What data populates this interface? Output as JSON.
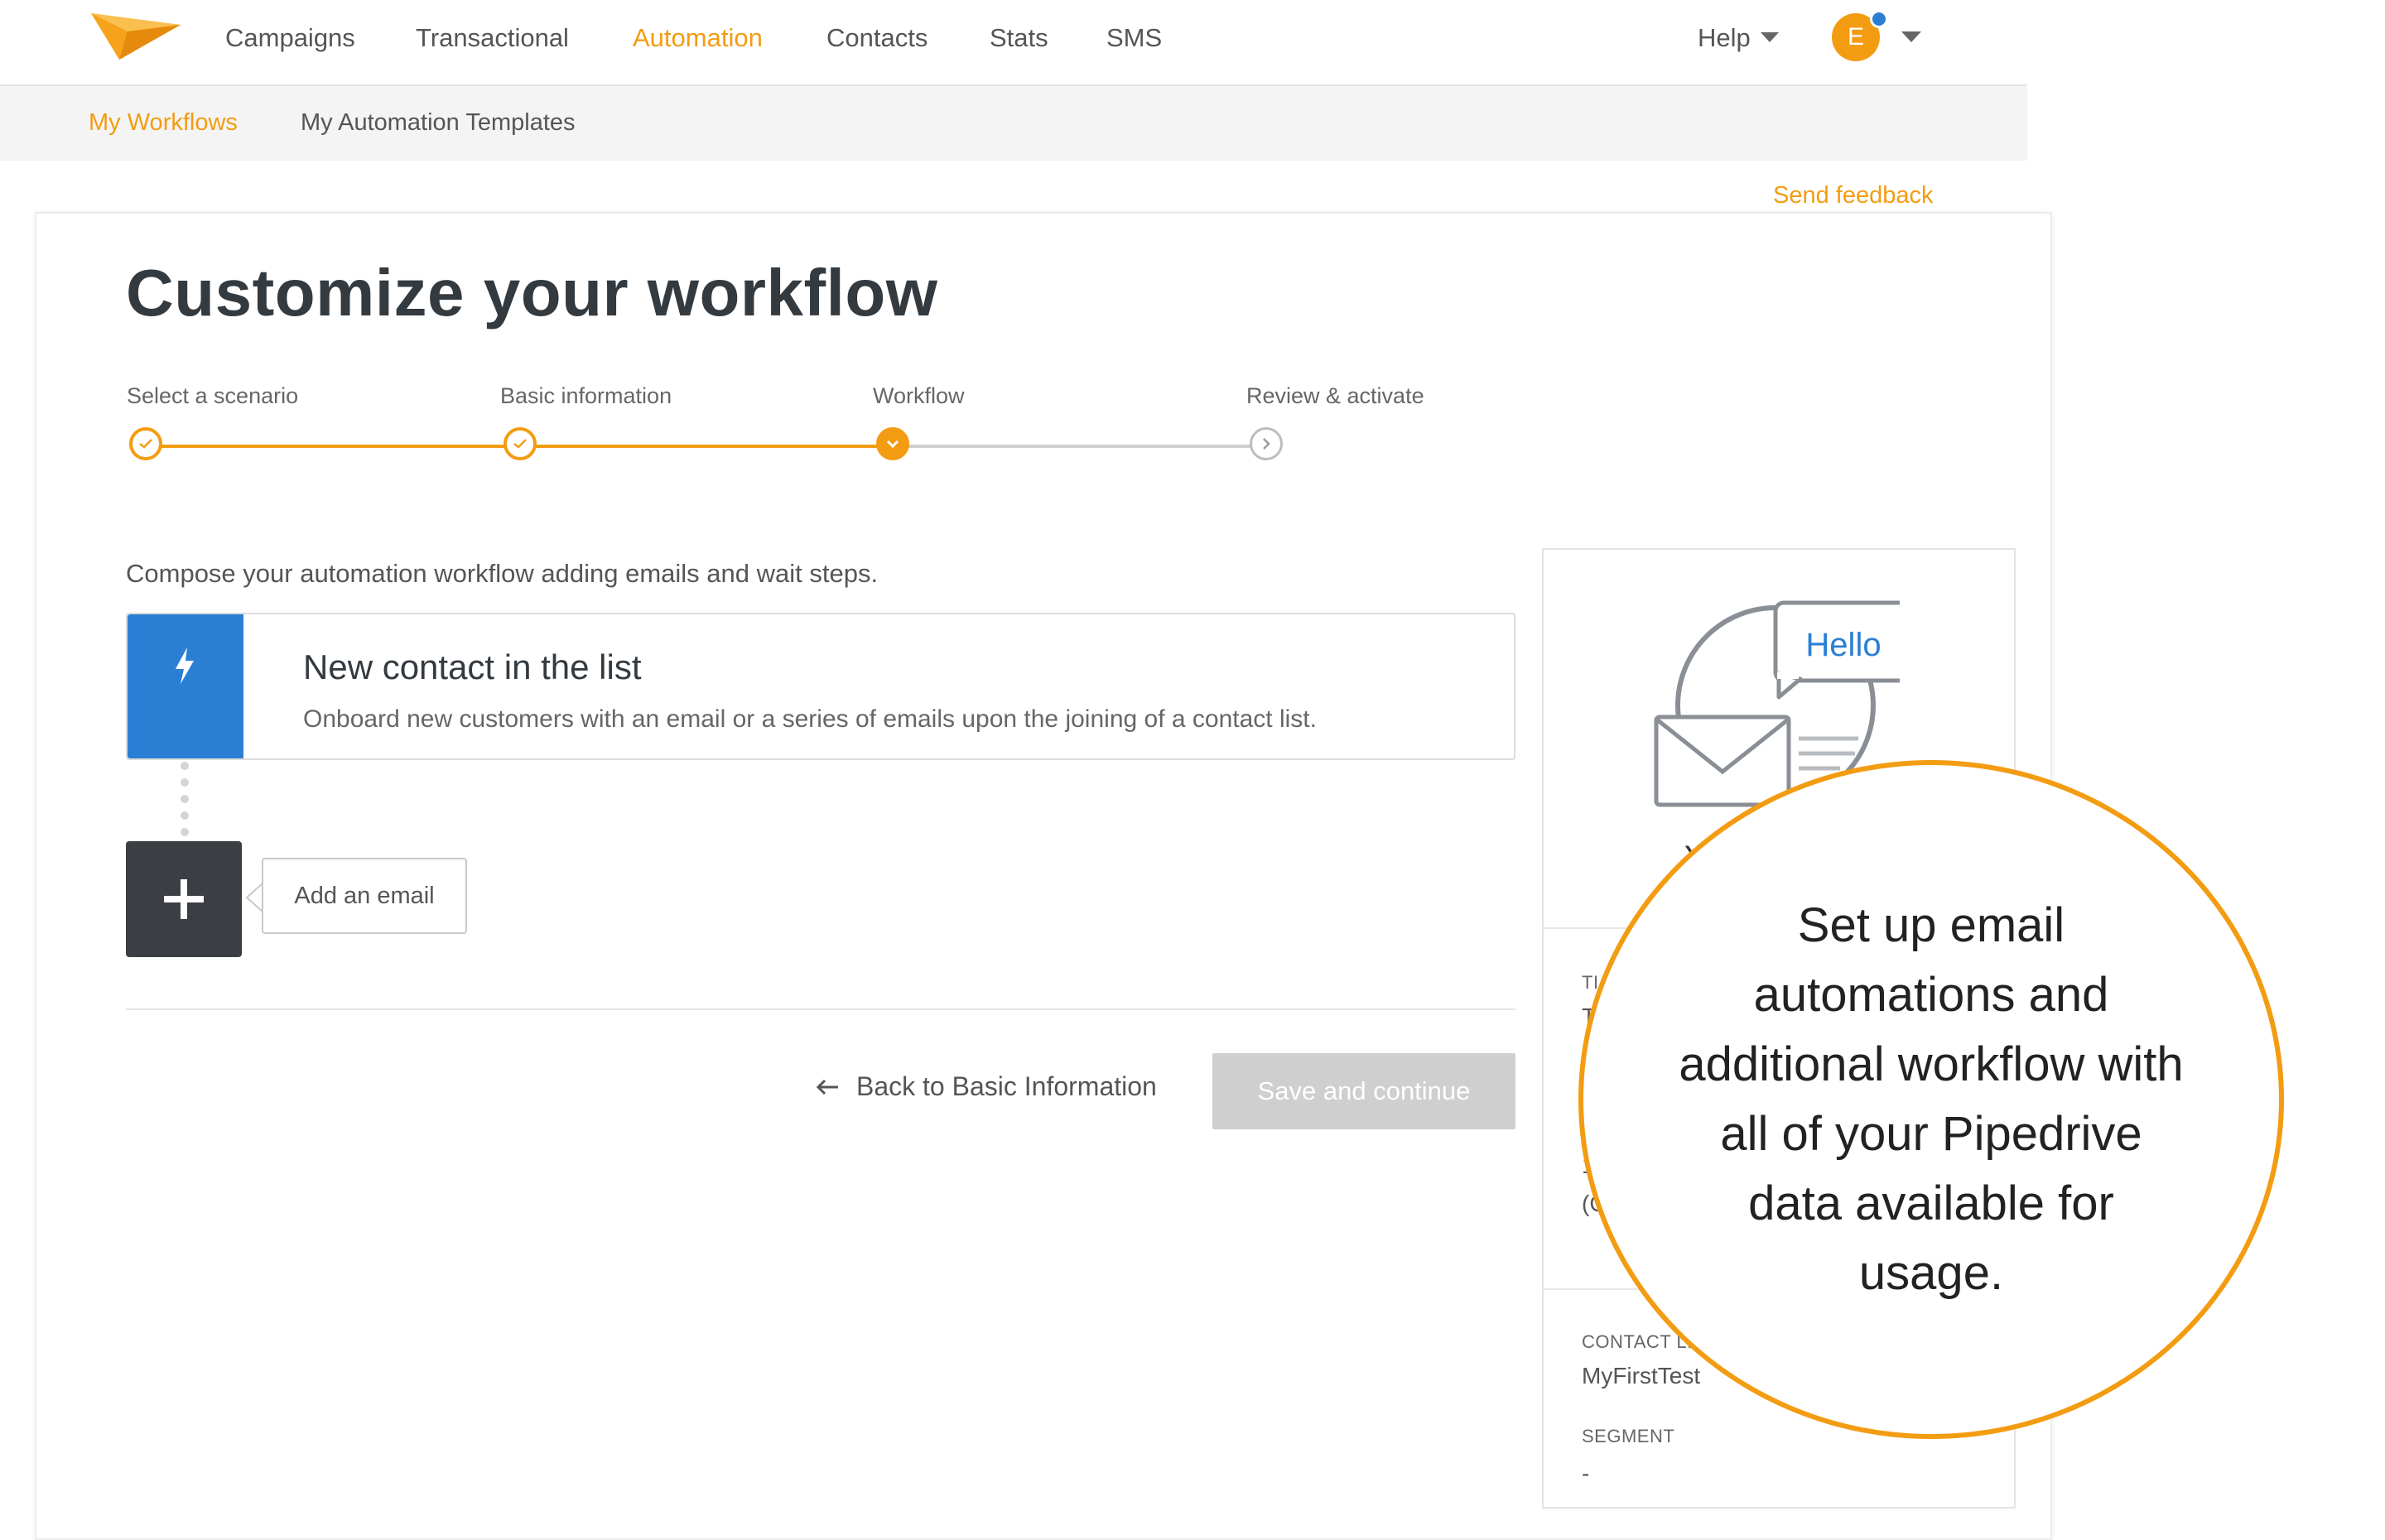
{
  "nav": {
    "items": [
      "Campaigns",
      "Transactional",
      "Automation",
      "Contacts",
      "Stats",
      "SMS"
    ],
    "active": "Automation",
    "help": "Help",
    "avatar_letter": "E"
  },
  "subnav": {
    "items": [
      "My Workflows",
      "My Automation Templates"
    ],
    "active": "My Workflows"
  },
  "feedback_link": "Send feedback",
  "page_title": "Customize your workflow",
  "steps": [
    {
      "label": "Select a scenario",
      "state": "done"
    },
    {
      "label": "Basic information",
      "state": "done"
    },
    {
      "label": "Workflow",
      "state": "current"
    },
    {
      "label": "Review & activate",
      "state": "pending"
    }
  ],
  "compose_description": "Compose your automation workflow adding emails and wait steps.",
  "trigger": {
    "title": "New contact in the list",
    "description": "Onboard new customers with an email or a series of emails upon the joining of a contact list."
  },
  "add_email_label": "Add an email",
  "back_link": "Back to Basic Information",
  "save_button": "Save and continue",
  "illustration_bubble": "Hello",
  "side_panel": {
    "title_label": "TI",
    "title_value": "T",
    "partial_1": "1",
    "partial_2": "(C",
    "contact_list_label": "CONTACT LI",
    "contact_list_value": "MyFirstTest",
    "segment_label": "SEGMENT",
    "segment_value": "-",
    "partial_heading": "Y"
  },
  "callout_text": "Set up email automations and additional workflow with all of your Pipedrive data available for usage.",
  "colors": {
    "accent": "#f39c12",
    "trigger_blue": "#2a7fd4",
    "dark_box": "#3b3f44",
    "disabled_button": "#cfcfcf"
  }
}
